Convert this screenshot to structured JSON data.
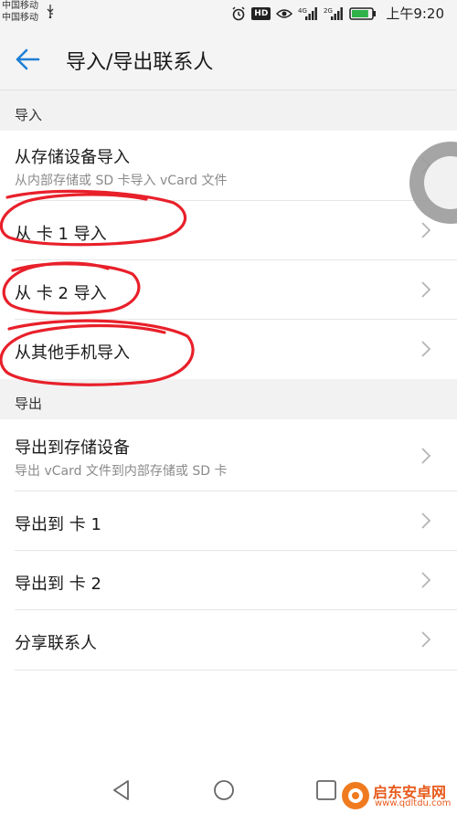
{
  "status_bar": {
    "carrier_1": "中国移动",
    "carrier_2": "中国移动",
    "hd_label": "HD",
    "time": "上午9:20",
    "icons": [
      "usb-icon",
      "alarm-icon",
      "eye-icon",
      "signal-4g-icon",
      "signal-2g-icon",
      "battery-icon"
    ],
    "battery_level": 0.85,
    "battery_color": "#2fb24a"
  },
  "header": {
    "title": "导入/导出联系人",
    "back_icon": "arrow-left-icon",
    "accent_color": "#1f7fd6"
  },
  "import_section": {
    "label": "导入",
    "items": [
      {
        "title": "从存储设备导入",
        "subtitle": "从内部存储或 SD 卡导入 vCard 文件"
      },
      {
        "title": "从 卡 1 导入"
      },
      {
        "title": "从 卡 2 导入"
      },
      {
        "title": "从其他手机导入"
      }
    ]
  },
  "export_section": {
    "label": "导出",
    "items": [
      {
        "title": "导出到存储设备",
        "subtitle": "导出 vCard 文件到内部存储或 SD 卡"
      },
      {
        "title": "导出到 卡 1"
      },
      {
        "title": "导出到 卡 2"
      },
      {
        "title": "分享联系人"
      }
    ]
  },
  "annotation_color": "#e8202a",
  "nav_bar": {
    "icons": [
      "back-triangle-icon",
      "home-circle-icon",
      "recents-square-icon"
    ]
  },
  "watermark": {
    "name": "启东安卓网",
    "url": "www.qdltdu.com"
  }
}
